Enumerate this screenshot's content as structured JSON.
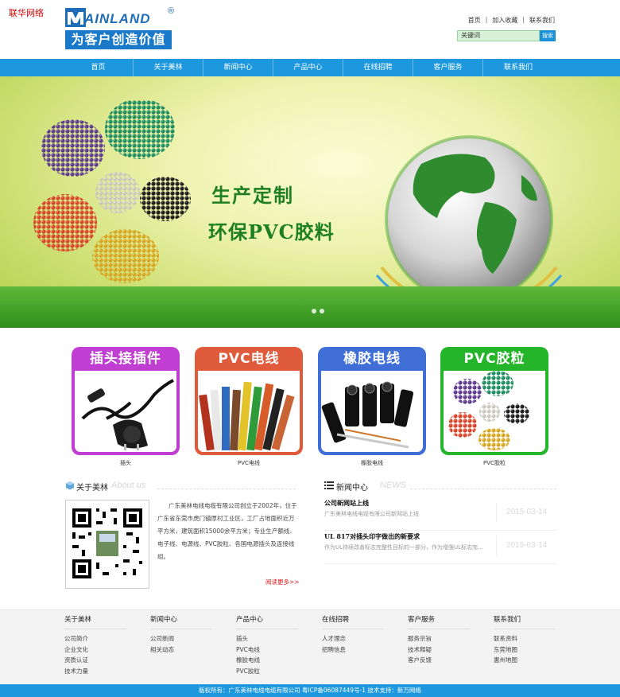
{
  "corner_tag": "联华网络",
  "logo": {
    "wordmark": "AINLAND",
    "reg": "®",
    "slogan": "为客户创造价值"
  },
  "top_links": [
    "首页",
    "加入收藏",
    "联系我们"
  ],
  "search": {
    "value": "关键词",
    "button": "搜索"
  },
  "nav": [
    "首页",
    "关于美林",
    "新闻中心",
    "产品中心",
    "在线招聘",
    "客户服务",
    "联系我们"
  ],
  "banner": {
    "title1": "生产定制",
    "title2": "环保PVC胶料"
  },
  "products": [
    {
      "label": "插头接插件",
      "caption": "插头",
      "color": "#c03fd2"
    },
    {
      "label": "PVC电线",
      "caption": "PVC电线",
      "color": "#e05a3c"
    },
    {
      "label": "橡胶电线",
      "caption": "橡胶电线",
      "color": "#3f6fd6"
    },
    {
      "label": "PVC胶粒",
      "caption": "PVC胶粒",
      "color": "#25b52a"
    }
  ],
  "about": {
    "title": "关于美林",
    "title_en": "About us",
    "text": "广东美林电线电缆有限公司创立于2002年，位于广东省东莞市虎门镇厚村工业区，工厂占地面积近万平方米，建筑面积15000余平方米；专业生产额线、电子线、电源线、PVC胶粒、各国电源插头及连接线组。",
    "more": "阅读更多>>"
  },
  "news": {
    "title": "新闻中心",
    "title_en": "NEWS",
    "items": [
      {
        "title": "公司新网站上线",
        "desc": "广东美林电线电缆有限公司新网站上线",
        "date": "2015-03-14"
      },
      {
        "title": "UL 817对插头印字做出的新要求",
        "desc": "作为UL持续改善标志完整性目标的一部分，作为增强UL标志完...",
        "date": "2015-03-14"
      }
    ]
  },
  "footer": [
    {
      "heading": "关于美林",
      "items": [
        "公司简介",
        "企业文化",
        "资质认证",
        "技术力量"
      ]
    },
    {
      "heading": "新闻中心",
      "items": [
        "公司新闻",
        "相关动态"
      ]
    },
    {
      "heading": "产品中心",
      "items": [
        "插头",
        "PVC电线",
        "橡胶电线",
        "PVC胶粒"
      ]
    },
    {
      "heading": "在线招聘",
      "items": [
        "人才理念",
        "招聘信息"
      ]
    },
    {
      "heading": "客户服务",
      "items": [
        "服务宗旨",
        "技术释疑",
        "客户反馈"
      ]
    },
    {
      "heading": "联系我们",
      "items": [
        "联系资料",
        "东莞地图",
        "惠州地图"
      ]
    }
  ],
  "copyright": "版权所有：广东美林电线电缆有限公司    粤ICP备06087449号-1    技术支持：新万网络",
  "colors": {
    "nav": "#1d98de",
    "brand": "#1f6db8",
    "banner_text": "#1e7f22"
  }
}
